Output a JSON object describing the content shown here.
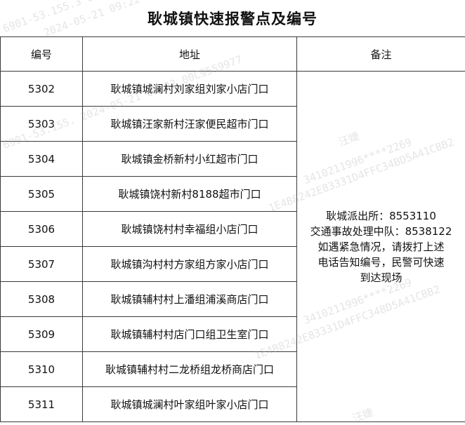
{
  "title": "耿城镇快速报警点及编号",
  "columns": {
    "number": "编号",
    "address": "地址",
    "note": "备注"
  },
  "rows": [
    {
      "number": "5302",
      "address": "耿城镇城澜村刘家组刘家小店门口"
    },
    {
      "number": "5303",
      "address": "耿城镇汪家新村汪家便民超市门口"
    },
    {
      "number": "5304",
      "address": "耿城镇金桥新村小红超市门口"
    },
    {
      "number": "5305",
      "address": "耿城镇饶村新村8188超市门口"
    },
    {
      "number": "5306",
      "address": "耿城镇饶村村幸福组小店门口"
    },
    {
      "number": "5307",
      "address": "耿城镇沟村村方家组方家小店门口"
    },
    {
      "number": "5308",
      "address": "耿城镇辅村村上潘组浦溪商店门口"
    },
    {
      "number": "5309",
      "address": "耿城镇辅村村店门口组卫生室门口"
    },
    {
      "number": "5310",
      "address": "耿城镇辅村村二龙桥组龙桥商店门口"
    },
    {
      "number": "5311",
      "address": "耿城镇城澜村叶家组叶家小店门口"
    }
  ],
  "note": {
    "line1": "耿城派出所：8553110",
    "line2": "交通事故处理中队：8538122",
    "line3": "如遇紧急情况，请拨打上述",
    "line4": "电话告知编号，民警可快速",
    "line5": "到达现场"
  },
  "watermarks": [
    {
      "text": "6901-53.155.3 09:22 3410211996****2269 1E4B8242E83331D4FFC34BD5A41CBB2"
    },
    {
      "text": "2024-05-21 09:22"
    },
    {
      "text": "汪婕"
    },
    {
      "text": "3410211996****2269"
    },
    {
      "text": "1E4B8242E83331D4FFC34BD5A41CBB2"
    },
    {
      "text": "6901-53.155.  2024-05-21 09:22 00C9559977"
    },
    {
      "text": "汪婕"
    },
    {
      "text": "3410211996****2269"
    },
    {
      "text": "1E4B8242E83331D4FFC34BD5A41CBB2"
    }
  ],
  "colors": {
    "border": "#3a3a3a",
    "text": "#111111",
    "watermark": "#a0a0a0"
  }
}
